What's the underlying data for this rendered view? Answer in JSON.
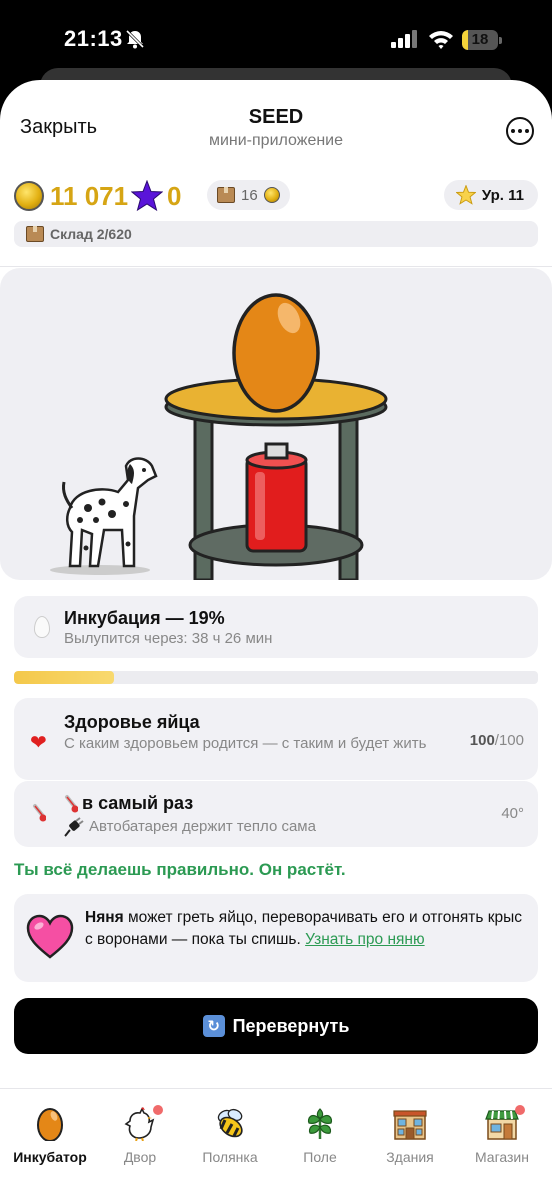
{
  "status_bar": {
    "time": "21:13",
    "battery": "18",
    "battery_fraction": 0.18
  },
  "header": {
    "close_label": "Закрыть",
    "title": "SEED",
    "subtitle": "мини-приложение"
  },
  "stats": {
    "coins": "11 071",
    "stars": "0",
    "box_count": "16",
    "level": "Ур. 11",
    "warehouse": "Склад 2/620"
  },
  "incubation": {
    "title": "Инкубация — 19%",
    "subtitle": "Вылупится через: 38 ч 26 мин",
    "progress": 0.19
  },
  "health": {
    "title": "Здоровье яйца",
    "subtitle": "С каким здоровьем родится — с таким и будет жить",
    "value": "100",
    "max": "/100"
  },
  "temperature": {
    "title": "в самый раз",
    "subtitle": "Автобатарея держит тепло сама",
    "value": "40°"
  },
  "status_message": "Ты всё делаешь правильно. Он растёт.",
  "nanny": {
    "name": "Няня",
    "text": " может греть яйцо, переворачивать его и отгонять крыс с воронами — пока ты спишь. ",
    "link": "Узнать про няню"
  },
  "flip_button": {
    "label": "Перевернуть"
  },
  "tabs": [
    {
      "label": "Инкубатор",
      "icon": "egg-icon",
      "active": true,
      "badge": false
    },
    {
      "label": "Двор",
      "icon": "chicken-icon",
      "active": false,
      "badge": true
    },
    {
      "label": "Полянка",
      "icon": "bee-icon",
      "active": false,
      "badge": false
    },
    {
      "label": "Поле",
      "icon": "plant-icon",
      "active": false,
      "badge": false
    },
    {
      "label": "Здания",
      "icon": "building-icon",
      "active": false,
      "badge": false
    },
    {
      "label": "Магазин",
      "icon": "shop-icon",
      "active": false,
      "badge": true
    }
  ],
  "colors": {
    "accent_gold": "#d6a514",
    "success_green": "#2c9a53",
    "progress_yellow": "#f4c84a",
    "badge_red": "#f06a6a"
  }
}
